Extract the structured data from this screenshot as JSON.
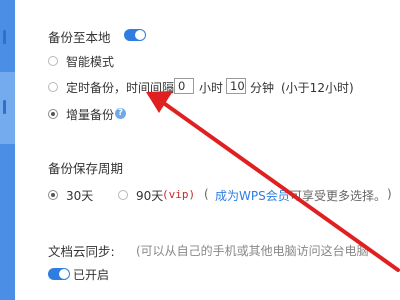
{
  "backup_local": {
    "title": "备份至本地",
    "options": {
      "smart": "智能模式",
      "timed_prefix": "定时备份，时间间隔",
      "hours_value": "0",
      "hours_unit": "小时",
      "minutes_value": "10",
      "minutes_unit": "分钟",
      "timed_note": "(小于12小时)",
      "incremental": "增量备份",
      "help_glyph": "?"
    },
    "toggle_on": true
  },
  "retention": {
    "title": "备份保存周期",
    "opt_30": "30天",
    "opt_90": "90天",
    "vip_tag": "(vip)",
    "paren_open": "(",
    "member_link": "成为WPS会员",
    "member_suffix": "可享受更多选择。",
    "paren_close": ")"
  },
  "cloud_sync": {
    "title": "文档云同步:",
    "desc": "(可以从自己的手机或其他电脑访问这台电脑",
    "toggle_label": "已开启"
  },
  "colors": {
    "accent": "#2f7de1",
    "sidebar": "#4a8ee6",
    "vip_red": "#c62828",
    "arrow_red": "#e02020"
  }
}
